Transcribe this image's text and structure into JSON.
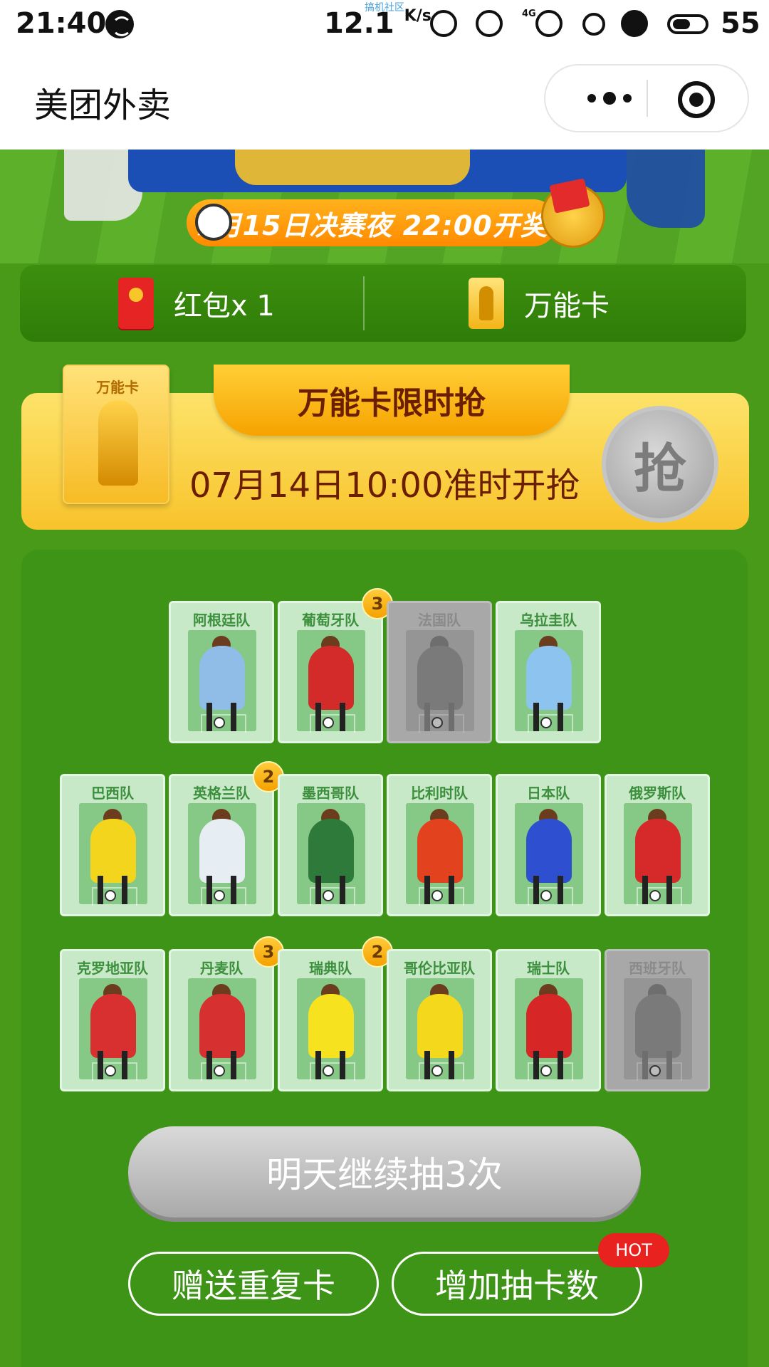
{
  "status": {
    "time": "21:40",
    "speed": "12.1",
    "speed_unit": "K/s",
    "watermark": "搞机社区",
    "net": "4G",
    "battery": "55"
  },
  "titlebar": {
    "title": "美团外卖"
  },
  "banner": {
    "strip_text": "7月15日决赛夜 22:00开奖"
  },
  "tabs": {
    "red_packet": "红包x 1",
    "wild_card": "万能卡"
  },
  "flash": {
    "ticket_label": "万能卡",
    "heading": "万能卡限时抢",
    "time_text": "07月14日10:00准时开抢",
    "grab_label": "抢"
  },
  "cards": [
    {
      "name": "阿根廷队",
      "collected": true,
      "count": "",
      "jersey": "#8fbde8"
    },
    {
      "name": "葡萄牙队",
      "collected": true,
      "count": "3",
      "jersey": "#d32a2a"
    },
    {
      "name": "法国队",
      "collected": false,
      "count": "",
      "jersey": "#7a7a7a"
    },
    {
      "name": "乌拉圭队",
      "collected": true,
      "count": "",
      "jersey": "#8cc3ef"
    },
    {
      "name": "巴西队",
      "collected": true,
      "count": "",
      "jersey": "#f3d51e"
    },
    {
      "name": "英格兰队",
      "collected": true,
      "count": "2",
      "jersey": "#e6eef3"
    },
    {
      "name": "墨西哥队",
      "collected": true,
      "count": "",
      "jersey": "#2e7a3a"
    },
    {
      "name": "比利时队",
      "collected": true,
      "count": "",
      "jersey": "#e2421e"
    },
    {
      "name": "日本队",
      "collected": true,
      "count": "",
      "jersey": "#2f4fd1"
    },
    {
      "name": "俄罗斯队",
      "collected": true,
      "count": "",
      "jersey": "#d62a2a"
    },
    {
      "name": "克罗地亚队",
      "collected": true,
      "count": "",
      "jersey": "#d83030"
    },
    {
      "name": "丹麦队",
      "collected": true,
      "count": "3",
      "jersey": "#d63030"
    },
    {
      "name": "瑞典队",
      "collected": true,
      "count": "2",
      "jersey": "#f6e21e"
    },
    {
      "name": "哥伦比亚队",
      "collected": true,
      "count": "",
      "jersey": "#f4d81c"
    },
    {
      "name": "瑞士队",
      "collected": true,
      "count": "",
      "jersey": "#d62626"
    },
    {
      "name": "西班牙队",
      "collected": false,
      "count": "",
      "jersey": "#7a7a7a"
    }
  ],
  "buttons": {
    "draw": "明天继续抽3次",
    "gift": "赠送重复卡",
    "add": "增加抽卡数",
    "hot": "HOT"
  }
}
